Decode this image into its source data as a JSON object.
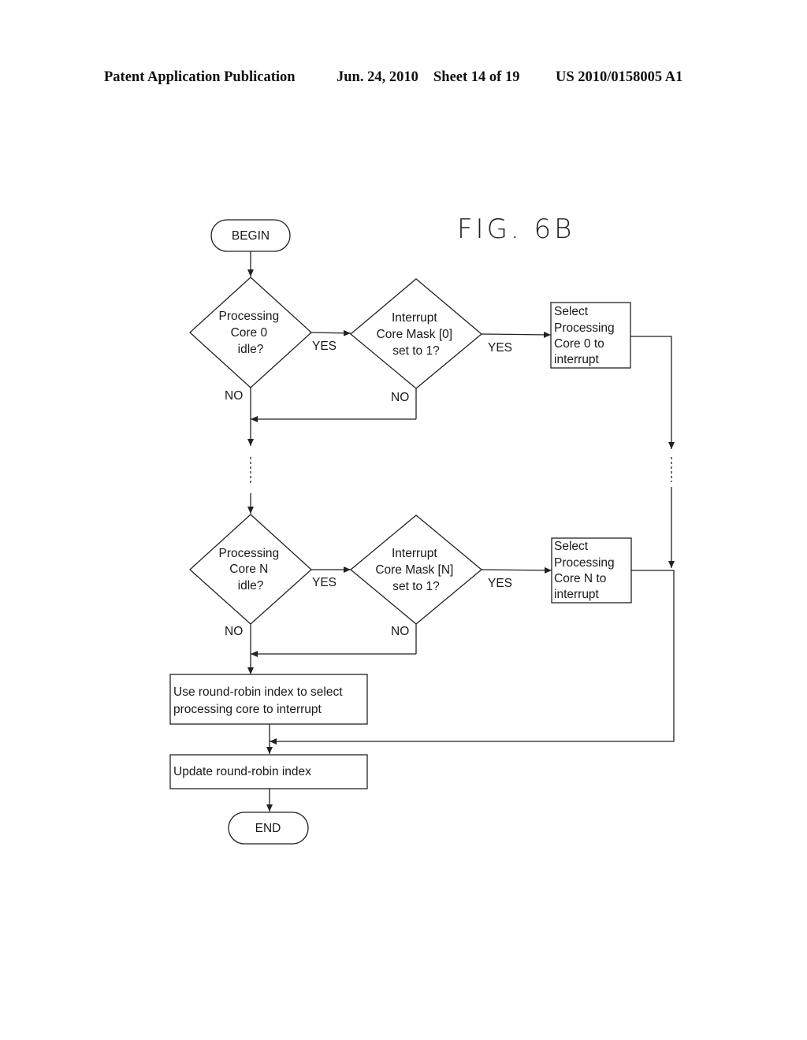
{
  "header": {
    "publication_type": "Patent Application Publication",
    "date": "Jun. 24, 2010",
    "sheet": "Sheet 14 of 19",
    "publication_number": "US 2010/0158005 A1"
  },
  "figure": {
    "label": "FIG. 6B",
    "begin": "BEGIN",
    "end": "END",
    "decisions": {
      "core0_idle": [
        "Processing",
        "Core 0",
        "idle?"
      ],
      "mask0_set": [
        "Interrupt",
        "Core Mask [0]",
        "set to 1?"
      ],
      "coreN_idle": [
        "Processing",
        "Core N",
        "idle?"
      ],
      "maskN_set": [
        "Interrupt",
        "Core Mask [N]",
        "set to 1?"
      ]
    },
    "processes": {
      "select_core0": [
        "Select",
        "Processing",
        "Core 0 to",
        "interrupt"
      ],
      "select_coreN": [
        "Select",
        "Processing",
        "Core N to",
        "interrupt"
      ],
      "round_robin_select": [
        "Use round-robin index to select",
        "processing core to interrupt"
      ],
      "update_index": [
        "Update round-robin index"
      ]
    },
    "branch_labels": {
      "yes": "YES",
      "no": "NO"
    }
  }
}
